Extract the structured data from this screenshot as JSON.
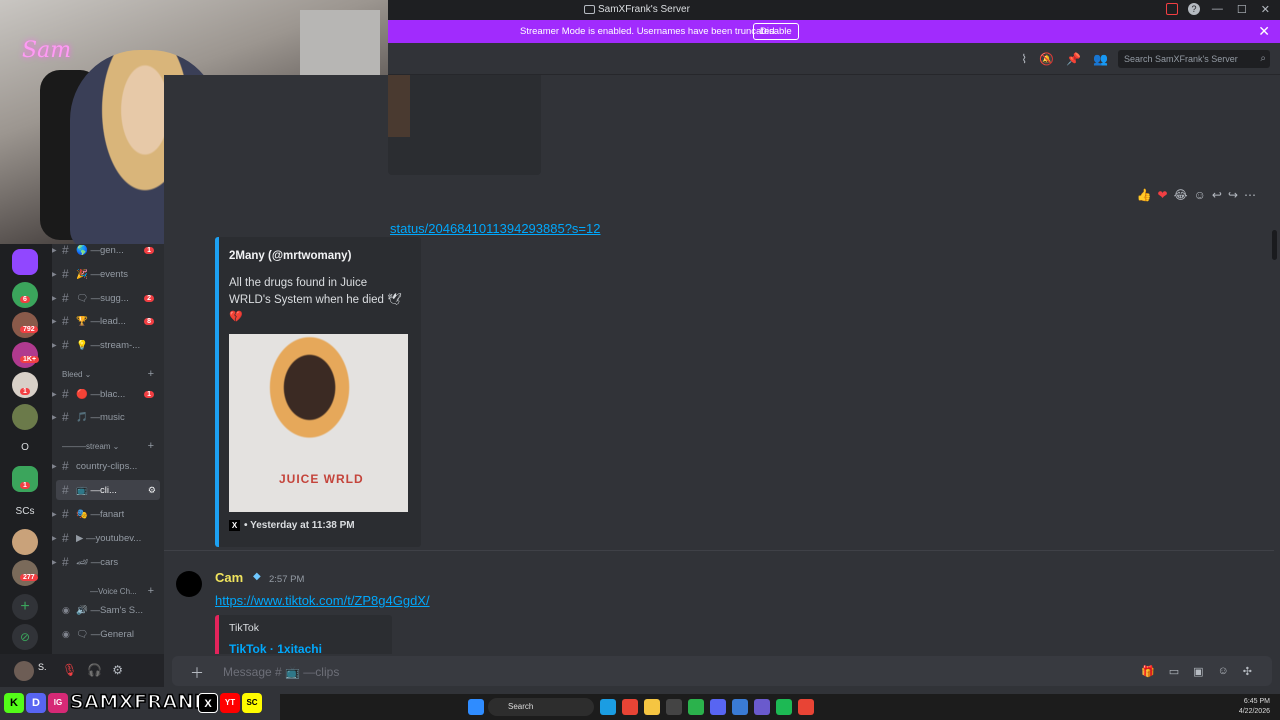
{
  "window": {
    "title": "SamXFrank's Server",
    "controls": [
      "—",
      "☐",
      "✕"
    ]
  },
  "banner": {
    "message": "Streamer Mode is enabled. Usernames have been truncated.",
    "disable_label": "Disable"
  },
  "header": {
    "search_placeholder": "Search SamXFrank's Server"
  },
  "server_rail": {
    "badges": [
      "6",
      "792",
      "1K+",
      "1",
      "1",
      "1",
      "277"
    ],
    "text_items": [
      "O",
      "SCs"
    ]
  },
  "sidebar": {
    "channels": [
      {
        "label": "🌎 —gen...",
        "badge": "1"
      },
      {
        "label": "🎉 —events",
        "badge": ""
      },
      {
        "label": "🗨 —sugg...",
        "badge": "2"
      },
      {
        "label": "🏆 —lead...",
        "badge": "8"
      },
      {
        "label": "💡 —stream-...",
        "badge": ""
      }
    ],
    "category_bleed": "Bleed ⌄",
    "channels2": [
      {
        "label": "🔴 —blac...",
        "badge": "1"
      },
      {
        "label": "🎵 —music",
        "badge": ""
      }
    ],
    "category_stream": "———stream ⌄",
    "channels3": [
      {
        "label": "country-clips...",
        "badge": ""
      },
      {
        "label": "📺 —cli...",
        "badge": ""
      },
      {
        "label": "🎭 —fanart",
        "badge": ""
      },
      {
        "label": "▶ —youtubev...",
        "badge": ""
      },
      {
        "label": "🏎 —cars",
        "badge": ""
      }
    ],
    "category_voice": "—Voice Ch...",
    "voice_channels": [
      {
        "label": "🔊 —Sam's S..."
      },
      {
        "label": "🗨 —General"
      }
    ]
  },
  "user_panel": {
    "name": "S."
  },
  "chat": {
    "link1": "status/2046841011394293885?s=12",
    "embed1": {
      "author": "2Many (@mrtwomany)",
      "description": "All the drugs found in Juice WRLD's System when he died 🕊",
      "heart": "💔",
      "image_text": "JUICE WRLD",
      "footer_source": "X",
      "footer_time": "• Yesterday at 11:38 PM"
    },
    "msg2": {
      "author": "Cam",
      "time": "2:57 PM",
      "link": "https://www.tiktok.com/t/ZP8g4GgdX/",
      "embed_provider": "TikTok",
      "embed_title": "TikTok · 1xitachi"
    }
  },
  "composer": {
    "placeholder": "Message # 📺 —clips"
  },
  "brand": {
    "handle": "SAMXFRANK",
    "icons": [
      "K",
      "D",
      "IG",
      "X",
      "YT",
      "SC"
    ]
  },
  "taskbar": {
    "search_label": "Search",
    "time": "6:45 PM",
    "date": "4/22/2026"
  },
  "colors": {
    "banner": "#a12bfd",
    "link": "#00a8fc",
    "twitter_accent": "#1da1f2",
    "tiktok_accent": "#e3245b",
    "cam_name": "#f0e45d"
  }
}
